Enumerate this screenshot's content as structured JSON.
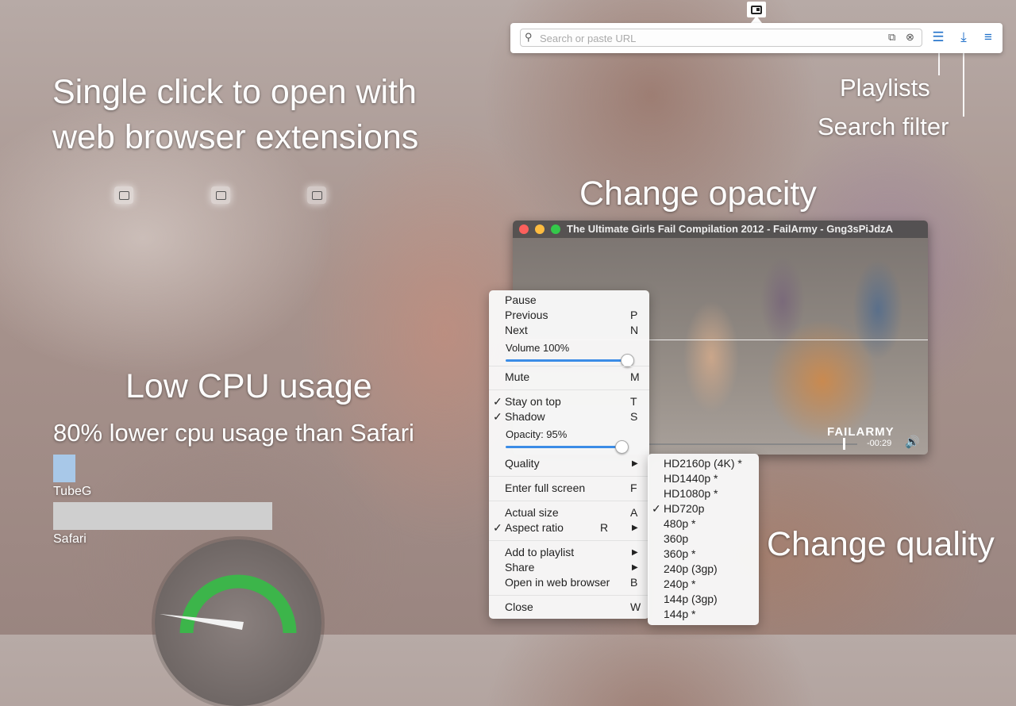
{
  "headlines": {
    "single_click_line1": "Single click to open with",
    "single_click_line2": "web browser extensions",
    "low_cpu": "Low CPU usage",
    "cpu_sub": "80% lower cpu usage than Safari",
    "change_opacity": "Change opacity",
    "change_quality": "Change quality",
    "playlists": "Playlists",
    "search_filter": "Search filter"
  },
  "toolbar": {
    "search_placeholder": "Search or paste URL",
    "search_icon": "search-icon",
    "accent_color": "#1e6fc9"
  },
  "player": {
    "title": "The Ultimate Girls Fail Compilation 2012 - FailArmy - Gng3sPiJdzA",
    "watermark": "FAILARMY",
    "time": "-00:29",
    "progress": 0.94,
    "traffic_lights": [
      "#fc605c",
      "#fdbc40",
      "#34c84a"
    ]
  },
  "context_menu": {
    "pause": {
      "label": "Pause",
      "key": ""
    },
    "previous": {
      "label": "Previous",
      "key": "P"
    },
    "next": {
      "label": "Next",
      "key": "N"
    },
    "volume_label": "Volume  100%",
    "volume_value": 1.0,
    "mute": {
      "label": "Mute",
      "key": "M"
    },
    "stay_on_top": {
      "label": "Stay on top",
      "key": "T",
      "checked": true
    },
    "shadow": {
      "label": "Shadow",
      "key": "S",
      "checked": true
    },
    "opacity_label": "Opacity:  95%",
    "opacity_value": 0.95,
    "quality": {
      "label": "Quality",
      "arrow": "▶"
    },
    "full_screen": {
      "label": "Enter full screen",
      "key": "F"
    },
    "actual_size": {
      "label": "Actual size",
      "key": "A"
    },
    "aspect_ratio": {
      "label": "Aspect ratio",
      "key": "R",
      "arrow": "▶",
      "checked": true
    },
    "add_to_playlist": {
      "label": "Add to playlist",
      "arrow": "▶"
    },
    "share": {
      "label": "Share",
      "arrow": "▶"
    },
    "open_in_browser": {
      "label": "Open in web browser",
      "key": "B"
    },
    "close": {
      "label": "Close",
      "key": "W"
    }
  },
  "quality_menu": {
    "items": [
      "HD2160p (4K) *",
      "HD1440p *",
      "HD1080p *",
      "HD720p",
      "480p *",
      "360p",
      "360p *",
      "240p (3gp)",
      "240p *",
      "144p (3gp)",
      "144p *"
    ],
    "selected_index": 3,
    "checkmark": "✓"
  },
  "cpu": {
    "tubeg_label": "TubeG",
    "safari_label": "Safari",
    "tubeg_color": "#a8c8e8",
    "safari_color": "#cfcfcf",
    "gauge_color": "#3cb54a"
  }
}
